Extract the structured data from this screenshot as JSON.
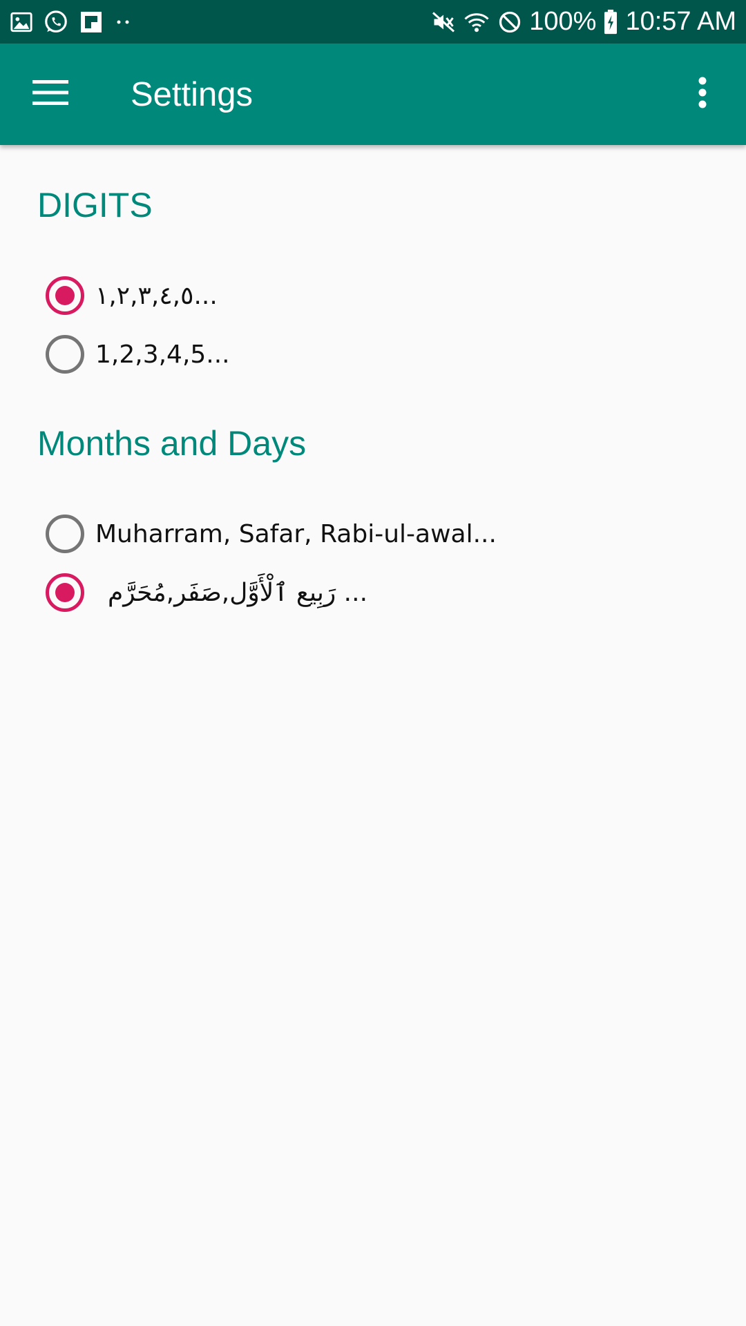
{
  "status_bar": {
    "left_icons": [
      "gallery-icon",
      "whatsapp-icon",
      "flipboard-icon",
      "more-notifications-icon"
    ],
    "right_icons": [
      "mute-vibrate-icon",
      "wifi-icon",
      "do-not-disturb-icon",
      "battery-charging-icon"
    ],
    "battery": "100%",
    "time": "10:57 AM"
  },
  "app_bar": {
    "title": "Settings",
    "menu_icon": "hamburger-menu-icon",
    "overflow_icon": "more-vert-icon",
    "color": "#00897b"
  },
  "sections": [
    {
      "header": "DIGITS",
      "options": [
        {
          "label": "١,٢,٣,٤,٥...",
          "checked": true
        },
        {
          "label": "1,2,3,4,5...",
          "checked": false
        }
      ]
    },
    {
      "header": "Months and Days",
      "options": [
        {
          "label": "Muharram, Safar, Rabi-ul-awal...",
          "checked": false
        },
        {
          "label": "... رَبِيع ٱلْأَوَّل,صَفَر,مُحَرَّم",
          "checked": true
        }
      ]
    }
  ],
  "colors": {
    "accent": "#d81b60",
    "header_text": "#00897b",
    "status_bar": "#00564b",
    "background": "#fafafa"
  }
}
